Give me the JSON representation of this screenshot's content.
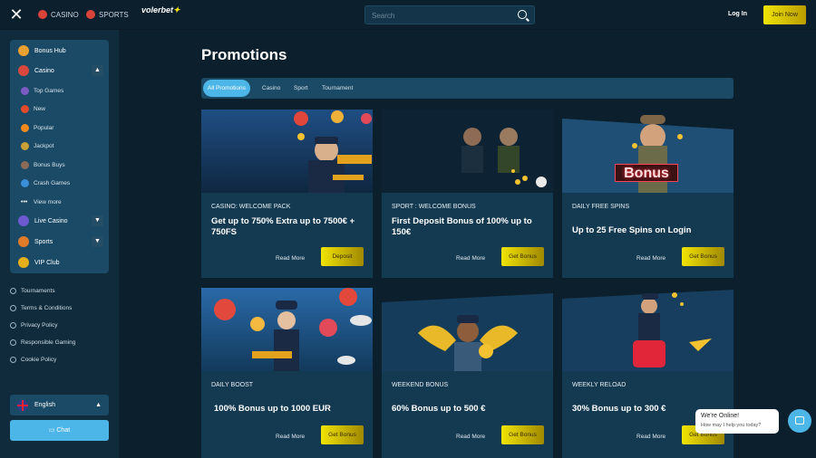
{
  "header": {
    "casino_label": "CASINO",
    "sports_label": "SPORTS",
    "logo_text": "volerbet",
    "search_placeholder": "Search",
    "login_label": "Log In",
    "join_label": "Join Now"
  },
  "sidebar": {
    "items": [
      {
        "label": "Bonus Hub"
      },
      {
        "label": "Casino"
      },
      {
        "label": "Top Games"
      },
      {
        "label": "New"
      },
      {
        "label": "Popular"
      },
      {
        "label": "Jackpot"
      },
      {
        "label": "Bonus Buys"
      },
      {
        "label": "Crash Games"
      },
      {
        "label": "View more"
      },
      {
        "label": "Live Casino"
      },
      {
        "label": "Sports"
      },
      {
        "label": "VIP Club"
      }
    ],
    "links": [
      "Tournaments",
      "Terms & Conditions",
      "Privacy Policy",
      "Responsible Gaming",
      "Cookie Policy"
    ],
    "language": "English",
    "chat_label": "Chat"
  },
  "main": {
    "title": "Promotions",
    "tabs": [
      "All Promotions",
      "Casino",
      "Sport",
      "Tournament"
    ],
    "cards": [
      {
        "category": "CASINO: WELCOME PACK",
        "headline": "Get up to 750% Extra up to 7500€ + 750FS",
        "more": "Read More",
        "cta": "Deposit"
      },
      {
        "category": "SPORT : WELCOME BONUS",
        "headline": "First Deposit Bonus of 100% up to 150€",
        "more": "Read More",
        "cta": "Get Bonus"
      },
      {
        "category": "DAILY FREE SPINS",
        "headline": "Up to 25 Free Spins on Login",
        "more": "Read More",
        "cta": "Get Bonus"
      },
      {
        "category": "DAILY BOOST",
        "headline": "100% Bonus up to 1000 EUR",
        "more": "Read More",
        "cta": "Get Bonus"
      },
      {
        "category": "WEEKEND BONUS",
        "headline": "60% Bonus up to 500 €",
        "more": "Read More",
        "cta": "Get Bonus"
      },
      {
        "category": "WEEKLY RELOAD",
        "headline": "30% Bonus up to 300 €",
        "more": "Read More",
        "cta": "Get Bonus"
      }
    ],
    "bonus_sign": "Bonus"
  },
  "chat_widget": {
    "title": "We're Online!",
    "subtitle": "How may I help you today?"
  }
}
